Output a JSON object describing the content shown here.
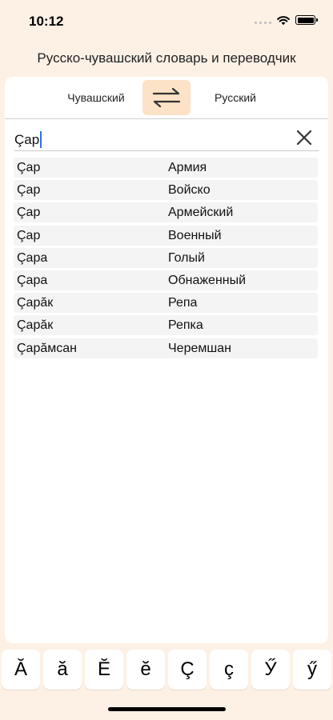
{
  "status_bar": {
    "time": "10:12"
  },
  "app_title": "Русско-чувашский словарь и переводчик",
  "languages": {
    "left": "Чувашский",
    "right": "Русский"
  },
  "search": {
    "value": "Çар"
  },
  "results": [
    {
      "cv": "Çар",
      "ru": "Армия"
    },
    {
      "cv": "Çар",
      "ru": "Войско"
    },
    {
      "cv": "Çар",
      "ru": "Армейский"
    },
    {
      "cv": "Çар",
      "ru": "Военный"
    },
    {
      "cv": "Çара",
      "ru": "Голый"
    },
    {
      "cv": "Çара",
      "ru": "Обнаженный"
    },
    {
      "cv": "Çарăк",
      "ru": "Репа"
    },
    {
      "cv": "Çарăк",
      "ru": "Репка"
    },
    {
      "cv": "Çарăмсан",
      "ru": "Черемшан"
    }
  ],
  "special_keys": [
    "Ă",
    "ă",
    "Ĕ",
    "ĕ",
    "Ç",
    "ç",
    "Ӳ",
    "ӳ"
  ],
  "colors": {
    "background": "#fdf1e6",
    "swap_highlight": "#fce2c6",
    "caret": "#2f6fe6"
  }
}
